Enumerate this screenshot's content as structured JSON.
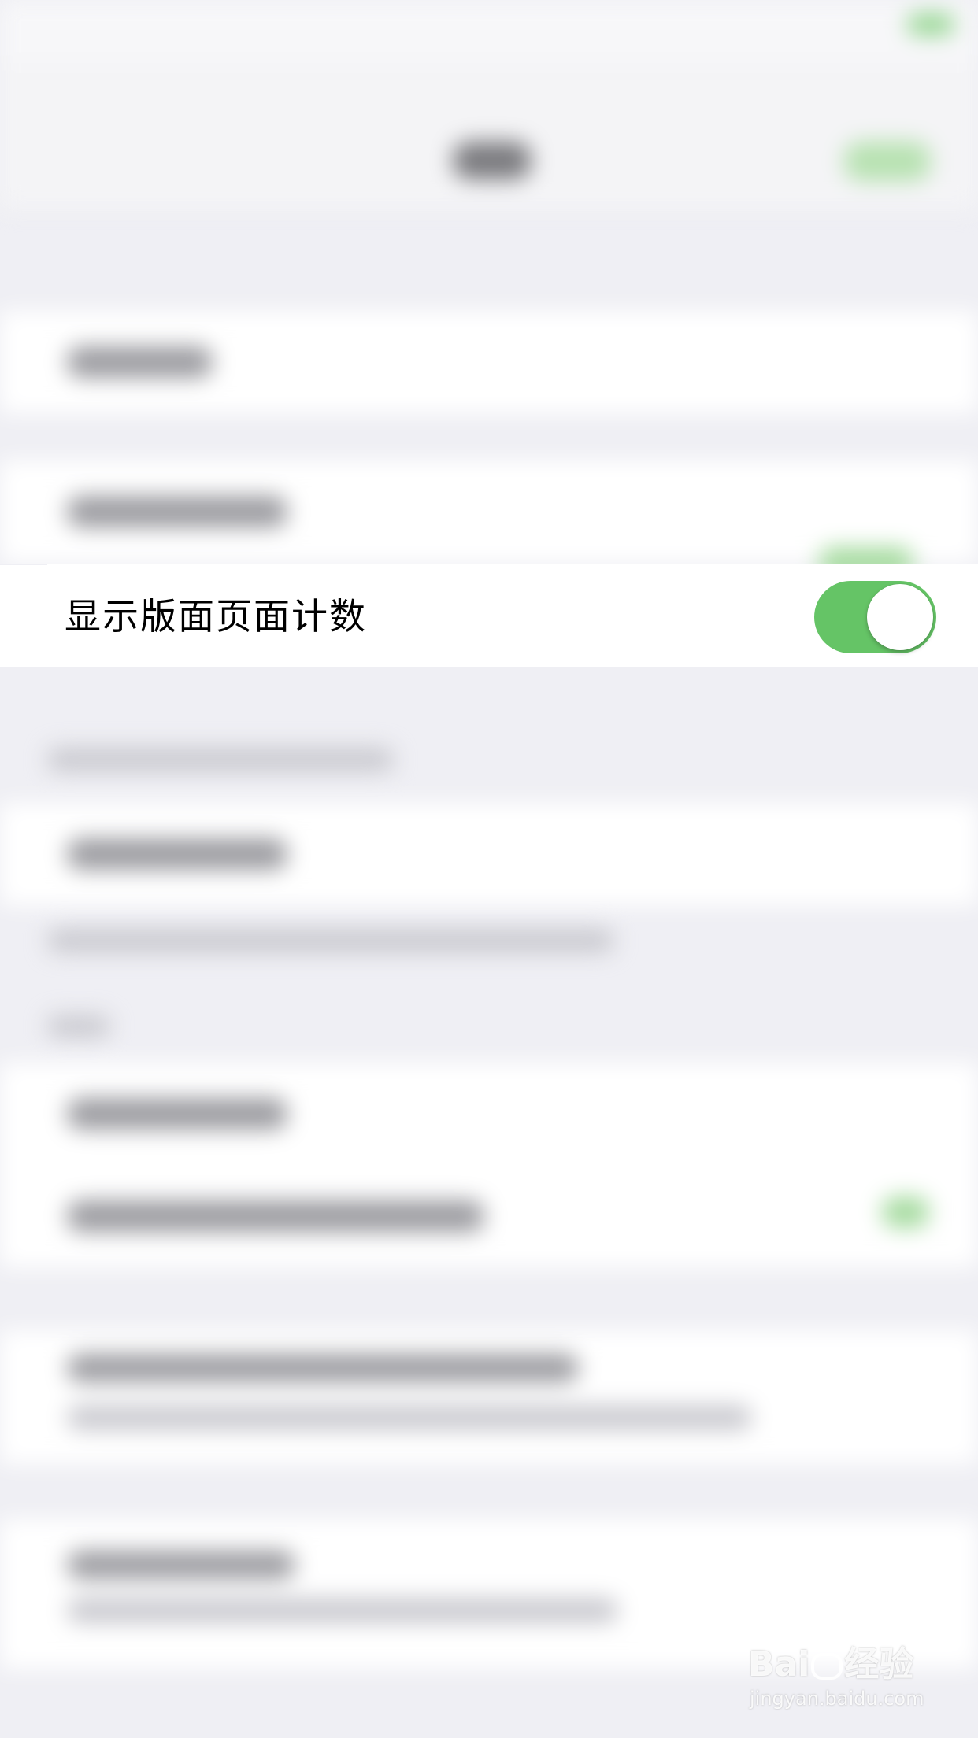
{
  "settings_row": {
    "label": "显示版面页面计数",
    "toggle_on": true
  },
  "colors": {
    "toggle_on": "#65c466",
    "background": "#efeff4",
    "separator": "#c8c7cc"
  },
  "watermark": {
    "logo_text_1": "Bai",
    "logo_text_2": "经验",
    "url": "jingyan.baidu.com"
  }
}
